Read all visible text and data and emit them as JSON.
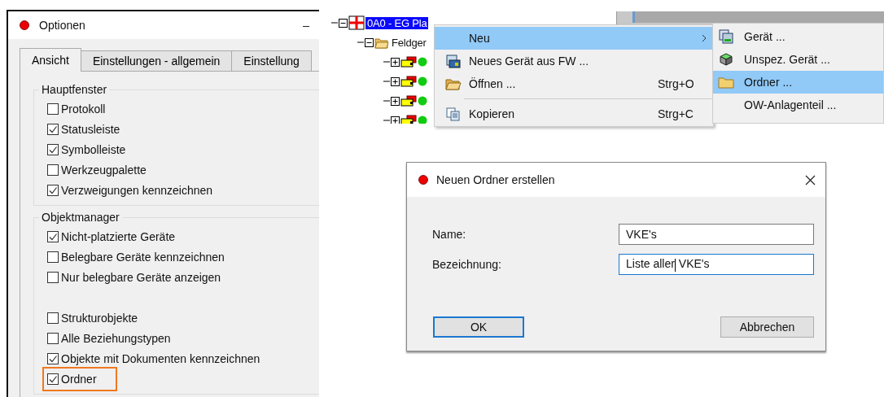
{
  "options_window": {
    "title": "Optionen",
    "tabs": [
      {
        "label": "Ansicht",
        "selected": true
      },
      {
        "label": "Einstellungen - allgemein",
        "selected": false
      },
      {
        "label": "Einstellung",
        "selected": false
      }
    ],
    "groups": [
      {
        "title": "Hauptfenster",
        "blocks": [
          [
            {
              "label": "Protokoll",
              "checked": false,
              "highlighted": false
            },
            {
              "label": "Statusleiste",
              "checked": true,
              "highlighted": false
            },
            {
              "label": "Symbolleiste",
              "checked": true,
              "highlighted": false
            },
            {
              "label": "Werkzeugpalette",
              "checked": false,
              "highlighted": false
            },
            {
              "label": "Verzweigungen kennzeichnen",
              "checked": true,
              "highlighted": false
            }
          ]
        ]
      },
      {
        "title": "Objektmanager",
        "blocks": [
          [
            {
              "label": "Nicht-platzierte Geräte",
              "checked": true,
              "highlighted": false
            },
            {
              "label": "Belegbare Geräte kennzeichnen",
              "checked": false,
              "highlighted": false
            },
            {
              "label": "Nur belegbare Geräte anzeigen",
              "checked": false,
              "highlighted": false
            }
          ],
          [
            {
              "label": "Strukturobjekte",
              "checked": false,
              "highlighted": false
            },
            {
              "label": "Alle Beziehungstypen",
              "checked": false,
              "highlighted": false
            },
            {
              "label": "Objekte mit Dokumenten kennzeichnen",
              "checked": true,
              "highlighted": false
            },
            {
              "label": "Ordner",
              "checked": true,
              "highlighted": true
            }
          ]
        ]
      }
    ]
  },
  "tree": {
    "rows": [
      {
        "kind": "structure",
        "label": "0A0 - EG Pla",
        "selected": true,
        "expanded": true,
        "children": [
          {
            "kind": "folder",
            "label": "Feldger",
            "selected": false,
            "expanded": true,
            "children": [
              {
                "kind": "device",
                "expanded": false
              },
              {
                "kind": "device",
                "expanded": false
              },
              {
                "kind": "device",
                "expanded": false
              },
              {
                "kind": "device",
                "expanded": false
              }
            ]
          }
        ]
      }
    ]
  },
  "context_menu": {
    "items": [
      {
        "kind": "item",
        "label": "Neu",
        "submenu": true,
        "selected": true
      },
      {
        "kind": "item",
        "label": "Neues Gerät aus FW ...",
        "submenu": false,
        "selected": false
      },
      {
        "kind": "item",
        "label": "Öffnen ...",
        "shortcut": "Strg+O",
        "submenu": false,
        "selected": false
      },
      {
        "kind": "separator"
      },
      {
        "kind": "item",
        "label": "Kopieren",
        "shortcut": "Strg+C",
        "submenu": false,
        "selected": false
      }
    ]
  },
  "submenu": {
    "items": [
      {
        "label": "Gerät ...",
        "selected": false
      },
      {
        "label": "Unspez. Gerät ...",
        "selected": false
      },
      {
        "label": "Ordner ...",
        "selected": true
      },
      {
        "label": "OW-Anlagenteil ...",
        "selected": false
      }
    ]
  },
  "dialog": {
    "title": "Neuen Ordner erstellen",
    "fields": [
      {
        "label": "Name:",
        "value": "VKE's",
        "focused": false
      },
      {
        "label": "Bezeichnung:",
        "value": "Liste aller VKE's",
        "focused": true
      }
    ],
    "buttons": [
      {
        "label": "OK",
        "default": true
      },
      {
        "label": "Abbrechen",
        "default": false
      }
    ]
  }
}
